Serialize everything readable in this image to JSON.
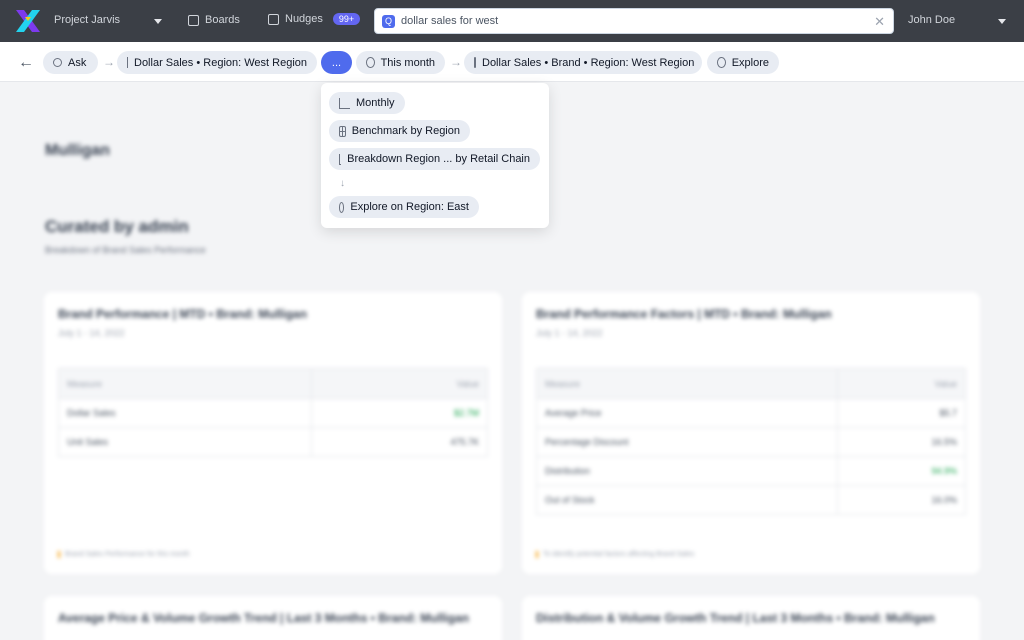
{
  "topbar": {
    "project": "Project Jarvis",
    "boards": "Boards",
    "nudges": "Nudges",
    "nudges_badge": "99+",
    "search_value": "dollar sales for west",
    "user": "John Doe"
  },
  "breadcrumb": {
    "ask": "Ask",
    "crumb1": "Dollar Sales • Region: West Region",
    "more": "...",
    "this_month": "This month",
    "crumb2": "Dollar Sales • Brand • Region: West Region",
    "explore": "Explore"
  },
  "dropdown": {
    "items": [
      "Monthly",
      "Benchmark by Region",
      "Breakdown Region ... by Retail Chain",
      "Explore on Region: East"
    ]
  },
  "page": {
    "title": "Mulligan",
    "section_title": "Curated by admin",
    "section_subtitle": "Breakdown of Brand Sales Performance",
    "cards": [
      {
        "title": "Brand Performance | MTD • Brand: Mulligan",
        "date": "July 1 - 14, 2022",
        "col_measure": "Measure",
        "col_value": "Value",
        "rows": [
          {
            "measure": "Dollar Sales",
            "value": "$2.7M"
          },
          {
            "measure": "Unit Sales",
            "value": "475.7K"
          }
        ],
        "note": "Brand Sales Performance for this month"
      },
      {
        "title": "Brand Performance Factors | MTD • Brand: Mulligan",
        "date": "July 1 - 14, 2022",
        "col_measure": "Measure",
        "col_value": "Value",
        "rows": [
          {
            "measure": "Average Price",
            "value": "$5.7"
          },
          {
            "measure": "Percentage Discount",
            "value": "16.5%"
          },
          {
            "measure": "Distribution",
            "value": "94.9%"
          },
          {
            "measure": "Out of Stock",
            "value": "16.0%"
          }
        ],
        "note": "To identify potential factors affecting Brand Sales"
      },
      {
        "title": "Average Price & Volume Growth Trend | Last 3 Months • Brand: Mulligan"
      },
      {
        "title": "Distribution & Volume Growth Trend | Last 3 Months • Brand: Mulligan"
      }
    ]
  },
  "colors": {
    "accent": "#4f6bed",
    "topbar": "#3b3f46",
    "positive": "#16a34a"
  }
}
